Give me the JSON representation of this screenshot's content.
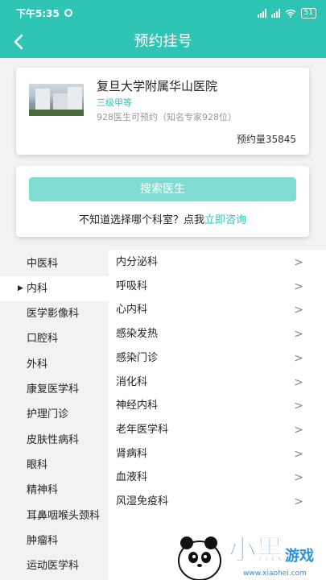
{
  "status_bar": {
    "time": "下午5:35",
    "battery": "51"
  },
  "header": {
    "title": "预约挂号",
    "back_icon": "chevron-left-icon"
  },
  "hospital": {
    "name": "复旦大学附属华山医院",
    "grade": "三级甲等",
    "doctors_text": "928医生可预约（知名专家928位）",
    "appointment_count": "预约量35845"
  },
  "search": {
    "button_label": "搜索医生",
    "prompt": "不知道选择哪个科室？点我",
    "link": "立即咨询"
  },
  "departments": [
    {
      "label": "中医科"
    },
    {
      "label": "内科",
      "selected": true
    },
    {
      "label": "医学影像科"
    },
    {
      "label": "口腔科"
    },
    {
      "label": "外科"
    },
    {
      "label": "康复医学科"
    },
    {
      "label": "护理门诊"
    },
    {
      "label": "皮肤性病科"
    },
    {
      "label": "眼科"
    },
    {
      "label": "精神科"
    },
    {
      "label": "耳鼻咽喉头颈科"
    },
    {
      "label": "肿瘤科"
    },
    {
      "label": "运动医学科"
    }
  ],
  "subdepartments": [
    {
      "label": "内分泌科"
    },
    {
      "label": "呼吸科"
    },
    {
      "label": "心内科"
    },
    {
      "label": "感染发热"
    },
    {
      "label": "感染门诊"
    },
    {
      "label": "消化科"
    },
    {
      "label": "神经内科"
    },
    {
      "label": "老年医学科"
    },
    {
      "label": "肾病科"
    },
    {
      "label": "血液科"
    },
    {
      "label": "风湿免疫科"
    }
  ],
  "watermark": {
    "text": "小黑游戏",
    "url": "www.xiaohei.com"
  },
  "colors": {
    "accent": "#2ec5b4",
    "button": "#7fdcd2"
  }
}
